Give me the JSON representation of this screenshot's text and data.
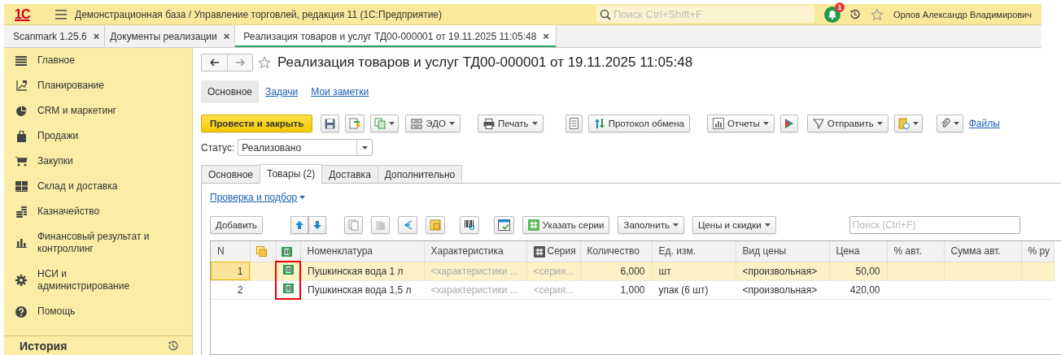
{
  "header": {
    "logo": "1С",
    "title": "Демонстрационная база / Управление торговлей, редакция 11  (1С:Предприятие)",
    "search": {
      "placeholder": "Поиск Ctrl+Shift+F"
    },
    "notifications": "1",
    "user": "Орлов Александр Владимирович"
  },
  "open_tabs": [
    {
      "label": "Scanmark 1.25.6",
      "close": "×",
      "selected": false
    },
    {
      "label": "Документы реализации",
      "close": "×",
      "selected": false
    },
    {
      "label": "Реализация товаров и услуг ТД00-000001 от 19.11.2025 11:05:48",
      "close": "×",
      "selected": true
    }
  ],
  "sidebar": {
    "items": [
      {
        "label": "Главное"
      },
      {
        "label": "Планирование"
      },
      {
        "label": "CRM и маркетинг"
      },
      {
        "label": "Продажи"
      },
      {
        "label": "Закупки"
      },
      {
        "label": "Склад и доставка"
      },
      {
        "label": "Казначейство"
      },
      {
        "label": "Финансовый результат и контроллинг"
      },
      {
        "label": "НСИ и администрирование"
      },
      {
        "label": "Помощь"
      }
    ],
    "footer": "История"
  },
  "document": {
    "title": "Реализация товаров и услуг ТД00-000001 от 19.11.2025 11:05:48",
    "favorite": false,
    "sections": [
      {
        "label": "Основное",
        "selected": true
      },
      {
        "label": "Задачи",
        "selected": false
      },
      {
        "label": "Мои заметки",
        "selected": false
      }
    ],
    "toolbar": [
      {
        "kind": "primary",
        "label": "Провести и закрыть",
        "dropdown": false
      },
      {
        "kind": "icon",
        "dropdown": false
      },
      {
        "kind": "icon",
        "dropdown": false
      },
      {
        "kind": "icon",
        "dropdown": true
      },
      {
        "kind": "button",
        "label": "ЭДО",
        "dropdown": true
      },
      {
        "kind": "button",
        "label": "Печать",
        "dropdown": true
      },
      {
        "kind": "icon",
        "dropdown": false
      },
      {
        "kind": "button",
        "label": "Протокол обмена",
        "dropdown": false
      },
      {
        "kind": "button",
        "label": "Отчеты",
        "dropdown": true
      },
      {
        "kind": "icon",
        "dropdown": false
      },
      {
        "kind": "button",
        "label": "Отправить",
        "dropdown": true
      },
      {
        "kind": "icon",
        "dropdown": true
      },
      {
        "kind": "icon",
        "dropdown": true
      },
      {
        "kind": "link",
        "label": "Файлы",
        "dropdown": false
      }
    ],
    "status": {
      "label": "Статус:",
      "value": "Реализовано"
    },
    "tabs": [
      {
        "label": "Основное",
        "selected": false
      },
      {
        "label": "Товары (2)",
        "selected": true
      },
      {
        "label": "Доставка",
        "selected": false
      },
      {
        "label": "Дополнительно",
        "selected": false
      }
    ],
    "check_link": "Проверка и подбор",
    "table_toolbar": [
      {
        "kind": "button",
        "label": "Добавить",
        "dropdown": false
      },
      {
        "kind": "icon",
        "dropdown": false
      },
      {
        "kind": "icon",
        "dropdown": false
      },
      {
        "kind": "icon",
        "dropdown": false
      },
      {
        "kind": "icon",
        "dropdown": false,
        "disabled": true
      },
      {
        "kind": "icon",
        "dropdown": false
      },
      {
        "kind": "icon",
        "dropdown": false
      },
      {
        "kind": "icon",
        "dropdown": false
      },
      {
        "kind": "icon",
        "dropdown": false
      },
      {
        "kind": "button",
        "label": "Указать серии",
        "dropdown": false
      },
      {
        "kind": "button",
        "label": "Заполнить",
        "dropdown": true
      },
      {
        "kind": "button",
        "label": "Цены и скидки",
        "dropdown": true
      }
    ],
    "table_search": {
      "placeholder": "Поиск (Ctrl+F)"
    },
    "table": {
      "columns": [
        {
          "kind": "numeric",
          "label": "N"
        },
        {
          "kind": "icon"
        },
        {
          "kind": "icon",
          "highlighted": true
        },
        {
          "kind": "text",
          "label": "Номенклатура"
        },
        {
          "kind": "text",
          "label": "Характеристика"
        },
        {
          "kind": "series",
          "label": "Серия"
        },
        {
          "kind": "numeric",
          "label": "Количество"
        },
        {
          "kind": "text",
          "label": "Ед. изм."
        },
        {
          "kind": "text",
          "label": "Вид цены"
        },
        {
          "kind": "numeric",
          "label": "Цена"
        },
        {
          "kind": "numeric",
          "label": "% авт."
        },
        {
          "kind": "numeric",
          "label": "Сумма авт."
        },
        {
          "kind": "numeric",
          "label": "% ру"
        }
      ],
      "rows": [
        {
          "selected": true,
          "cells": [
            {
              "text": "1"
            },
            {
              "text": ""
            },
            {
              "text": ""
            },
            {
              "text": "Пушкинская вода 1 л"
            },
            {
              "text": "<характеристики ...",
              "hint": true
            },
            {
              "text": "<серия...",
              "hint": true
            },
            {
              "text": "6,000"
            },
            {
              "text": "шт"
            },
            {
              "text": "<произвольная>"
            },
            {
              "text": "50,00"
            }
          ]
        },
        {
          "selected": false,
          "cells": [
            {
              "text": "2"
            },
            {
              "text": ""
            },
            {
              "text": ""
            },
            {
              "text": "Пушкинская вода 1,5 л"
            },
            {
              "text": "<характеристики ...",
              "hint": true
            },
            {
              "text": "<серия...",
              "hint": true
            },
            {
              "text": "1,000"
            },
            {
              "text": "упак (6 шт)"
            },
            {
              "text": "<произвольная>"
            },
            {
              "text": "420,00"
            }
          ]
        }
      ]
    }
  }
}
